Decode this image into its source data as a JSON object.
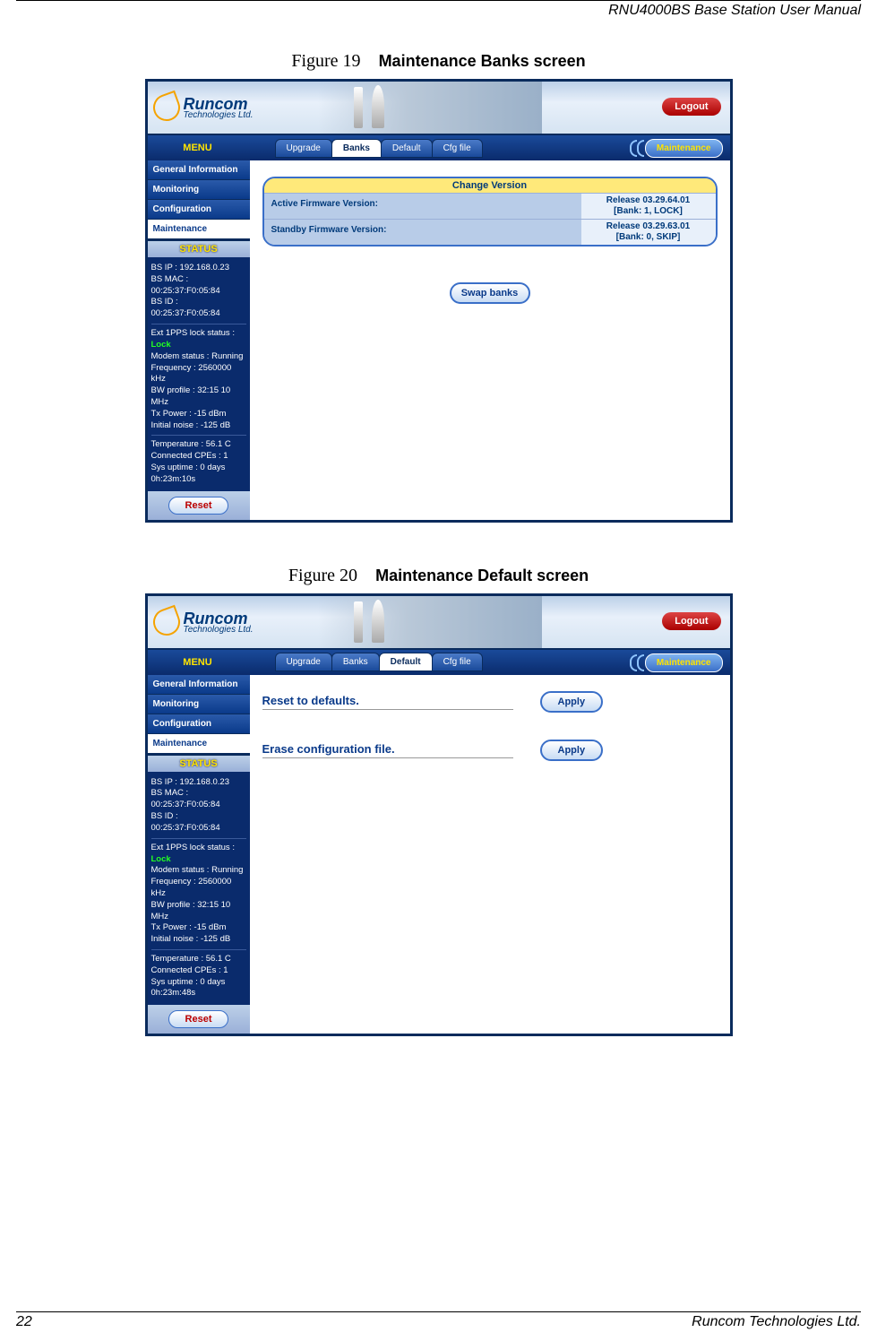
{
  "doc": {
    "header_title": "RNU4000BS Base Station User Manual",
    "page_number": "22",
    "footer_company": "Runcom Technologies Ltd."
  },
  "fig19": {
    "caption_prefix": "Figure 19",
    "caption_title": "Maintenance Banks screen"
  },
  "fig20": {
    "caption_prefix": "Figure 20",
    "caption_title": "Maintenance Default screen"
  },
  "app": {
    "logo_main": "Runcom",
    "logo_sub": "Technologies Ltd.",
    "logout": "Logout",
    "menu_label": "MENU",
    "tabs": {
      "upgrade": "Upgrade",
      "banks": "Banks",
      "default": "Default",
      "cfg": "Cfg file"
    },
    "breadcrumb": "Maintenance",
    "sidebar": {
      "general": "General Information",
      "monitoring": "Monitoring",
      "configuration": "Configuration",
      "maintenance": "Maintenance"
    },
    "status_label": "STATUS",
    "status1": {
      "bs_ip": "BS IP :  192.168.0.23",
      "bs_mac": "BS MAC :  00:25:37:F0:05:84",
      "bs_id": "BS ID :  00:25:37:F0:05:84",
      "lock_label": "Ext 1PPS lock status : ",
      "lock_value": "Lock",
      "modem": "Modem status :  Running",
      "freq": "Frequency :  2560000 kHz",
      "bw": "BW profile :  32:15 10 MHz",
      "tx": "Tx Power :  -15 dBm",
      "noise": "Initial noise :  -125 dB",
      "temp": "Temperature :  56.1 C",
      "cpes": "Connected CPEs :  1",
      "uptime": "Sys uptime :  0 days 0h:23m:10s"
    },
    "status2_uptime": "Sys uptime :  0 days 0h:23m:48s",
    "reset": "Reset"
  },
  "banks": {
    "heading": "Change Version",
    "row1_label": "Active Firmware Version:",
    "row1_value_a": "Release 03.29.64.01",
    "row1_value_b": "[Bank: 1, LOCK]",
    "row2_label": "Standby Firmware Version:",
    "row2_value_a": "Release 03.29.63.01",
    "row2_value_b": "[Bank: 0, SKIP]",
    "swap": "Swap banks"
  },
  "defaults": {
    "reset_label": "Reset to defaults.",
    "erase_label": "Erase configuration file.",
    "apply": "Apply"
  }
}
